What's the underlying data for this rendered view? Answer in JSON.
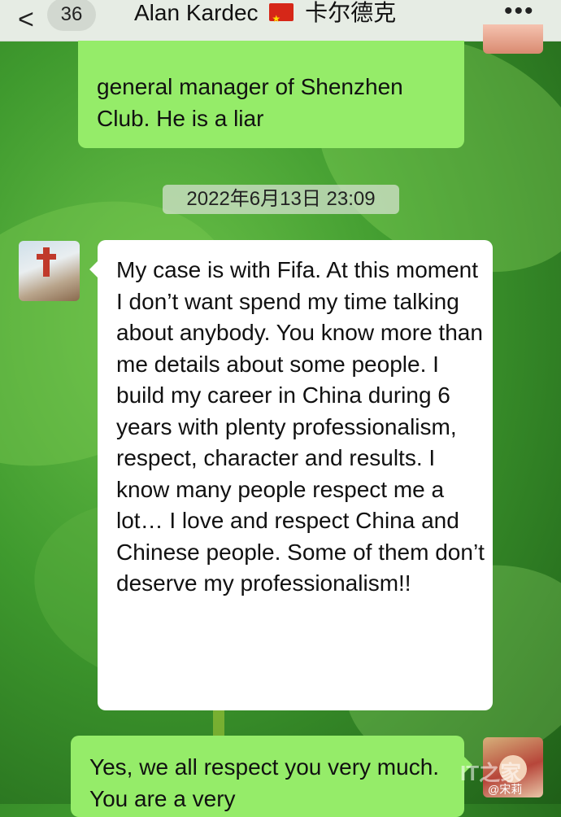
{
  "header": {
    "back_glyph": "<",
    "unread_count": "36",
    "title_name": "Alan Kardec",
    "title_flag": "china-flag",
    "title_chinese": "卡尔德克",
    "more_glyph": "•••"
  },
  "messages": [
    {
      "side": "right",
      "text": "general manager of Shenzhen Club. He is a liar"
    },
    {
      "side": "left",
      "text": "My case is with Fifa. At this moment  I don’t want spend my time talking about anybody.  You know more than me details about some people. I build my career in China during  6 years with plenty professionalism, respect, character and results. I know many people respect me a lot…  I love and respect China and Chinese people. Some of them don’t deserve my professionalism!!"
    },
    {
      "side": "right",
      "text": "Yes, we all respect you very much. You are a very"
    }
  ],
  "timestamp": "2022年6月13日 23:09",
  "watermark": {
    "logo_text": "IT之家",
    "credit": "@宋莉"
  },
  "colors": {
    "sent_bubble": "#95ec69",
    "received_bubble": "#ffffff",
    "topbar": "#e6ece4"
  }
}
